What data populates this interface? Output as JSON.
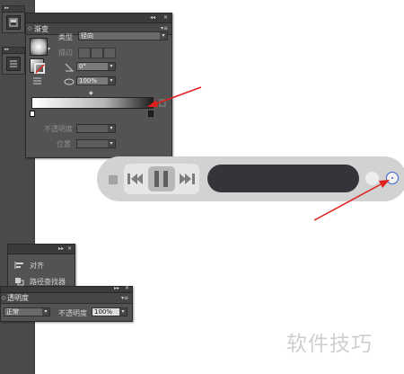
{
  "gradient_panel": {
    "title": "渐变",
    "type_label": "类型",
    "type_value": "径向",
    "stroke_label": "描边",
    "angle_value": "0°",
    "aspect_value": "100%",
    "opacity_label": "不透明度",
    "position_label": "位置"
  },
  "align_panel": {
    "align_label": "对齐",
    "pathfinder_label": "路径查找器"
  },
  "transparency_panel": {
    "title": "透明度",
    "blend_mode": "正常",
    "opacity_label": "不透明度",
    "opacity_value": "100%"
  },
  "watermark": "软件技巧",
  "colors": {
    "panel_bg": "#535353",
    "annotation_arrow": "#e0201c",
    "knob_outline": "#3a5fd0",
    "display_bg": "#33353a"
  }
}
